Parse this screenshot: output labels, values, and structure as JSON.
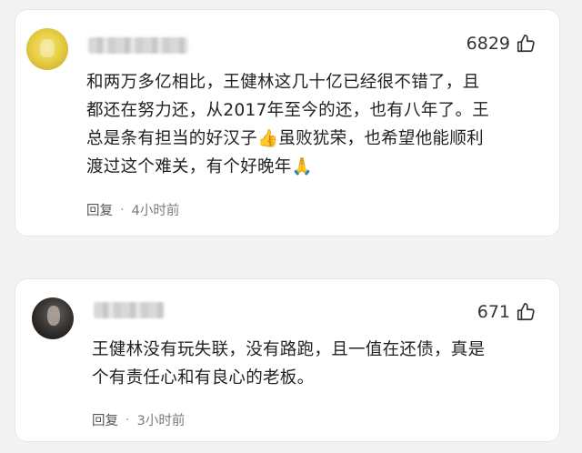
{
  "comments": [
    {
      "likes": "6829",
      "text": "和两万多亿相比，王健林这几十亿已经很不错了，且\n都还在努力还，从2017年至今的还，也有八年了。王\n总是条有担当的好汉子👍虽败犹荣，也希望他能顺利\n渡过这个难关，有个好晚年🙏",
      "reply_label": "回复",
      "separator": "·",
      "time": "4小时前",
      "avatar_color": "#e8cf45"
    },
    {
      "likes": "671",
      "text": "王健林没有玩失联，没有路跑，且一值在还债，真是\n个有责任心和有良心的老板。",
      "reply_label": "回复",
      "separator": "·",
      "time": "3小时前",
      "avatar_color": "#2a2725"
    }
  ],
  "icons": {
    "like": "thumbs-up-icon"
  }
}
